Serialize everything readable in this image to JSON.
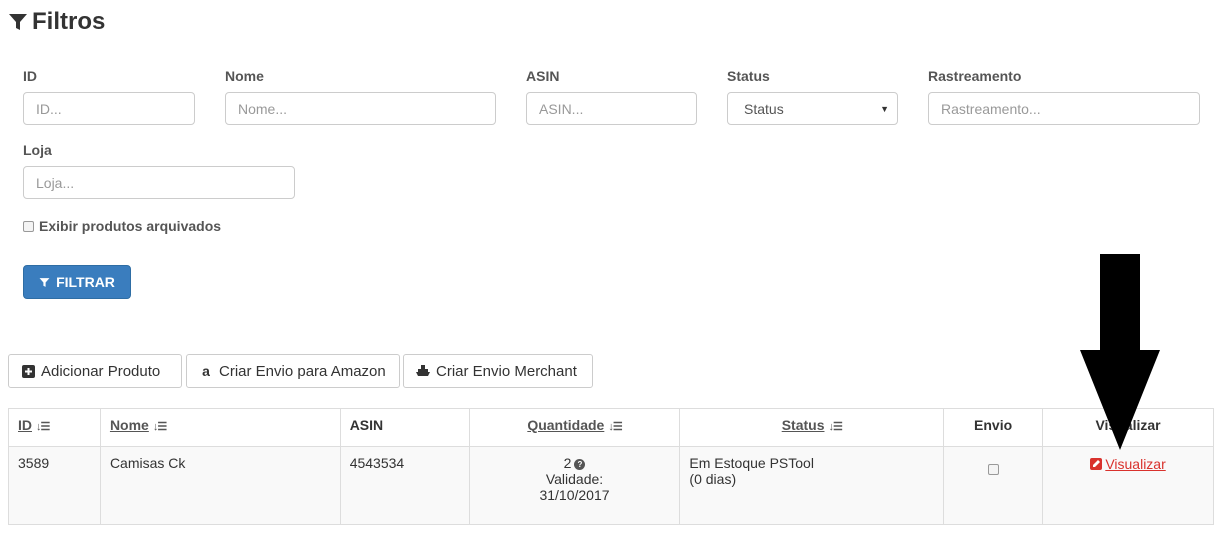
{
  "header": {
    "title": "Filtros"
  },
  "filters": {
    "id": {
      "label": "ID",
      "placeholder": "ID..."
    },
    "nome": {
      "label": "Nome",
      "placeholder": "Nome..."
    },
    "asin": {
      "label": "ASIN",
      "placeholder": "ASIN..."
    },
    "status": {
      "label": "Status",
      "value": "Status"
    },
    "rastreamento": {
      "label": "Rastreamento",
      "placeholder": "Rastreamento..."
    },
    "loja": {
      "label": "Loja",
      "placeholder": "Loja..."
    },
    "archived_label": "Exibir produtos arquivados",
    "filter_button": "FILTRAR"
  },
  "actions": {
    "add_product": "Adicionar Produto",
    "amazon_shipment": "Criar Envio para Amazon",
    "merchant_shipment": "Criar Envio Merchant"
  },
  "table": {
    "headers": {
      "id": "ID",
      "nome": "Nome",
      "asin": "ASIN",
      "quantidade": "Quantidade",
      "status": "Status",
      "envio": "Envio",
      "visualizar": "Visualizar"
    },
    "rows": [
      {
        "id": "3589",
        "nome": "Camisas Ck",
        "asin": "4543534",
        "quantidade": "2",
        "validade_label": "Validade:",
        "validade_date": "31/10/2017",
        "status": "Em Estoque PSTool",
        "status_days": "(0 dias)",
        "view_link": "Visualizar"
      }
    ]
  },
  "colors": {
    "primary": "#3a7dbe",
    "danger": "#d9322d",
    "arrow": "#000000"
  },
  "icons": [
    "filter-icon",
    "plus-square-icon",
    "amazon-icon",
    "ship-icon",
    "sort-icon",
    "help-icon",
    "edit-icon",
    "down-arrow-icon"
  ]
}
